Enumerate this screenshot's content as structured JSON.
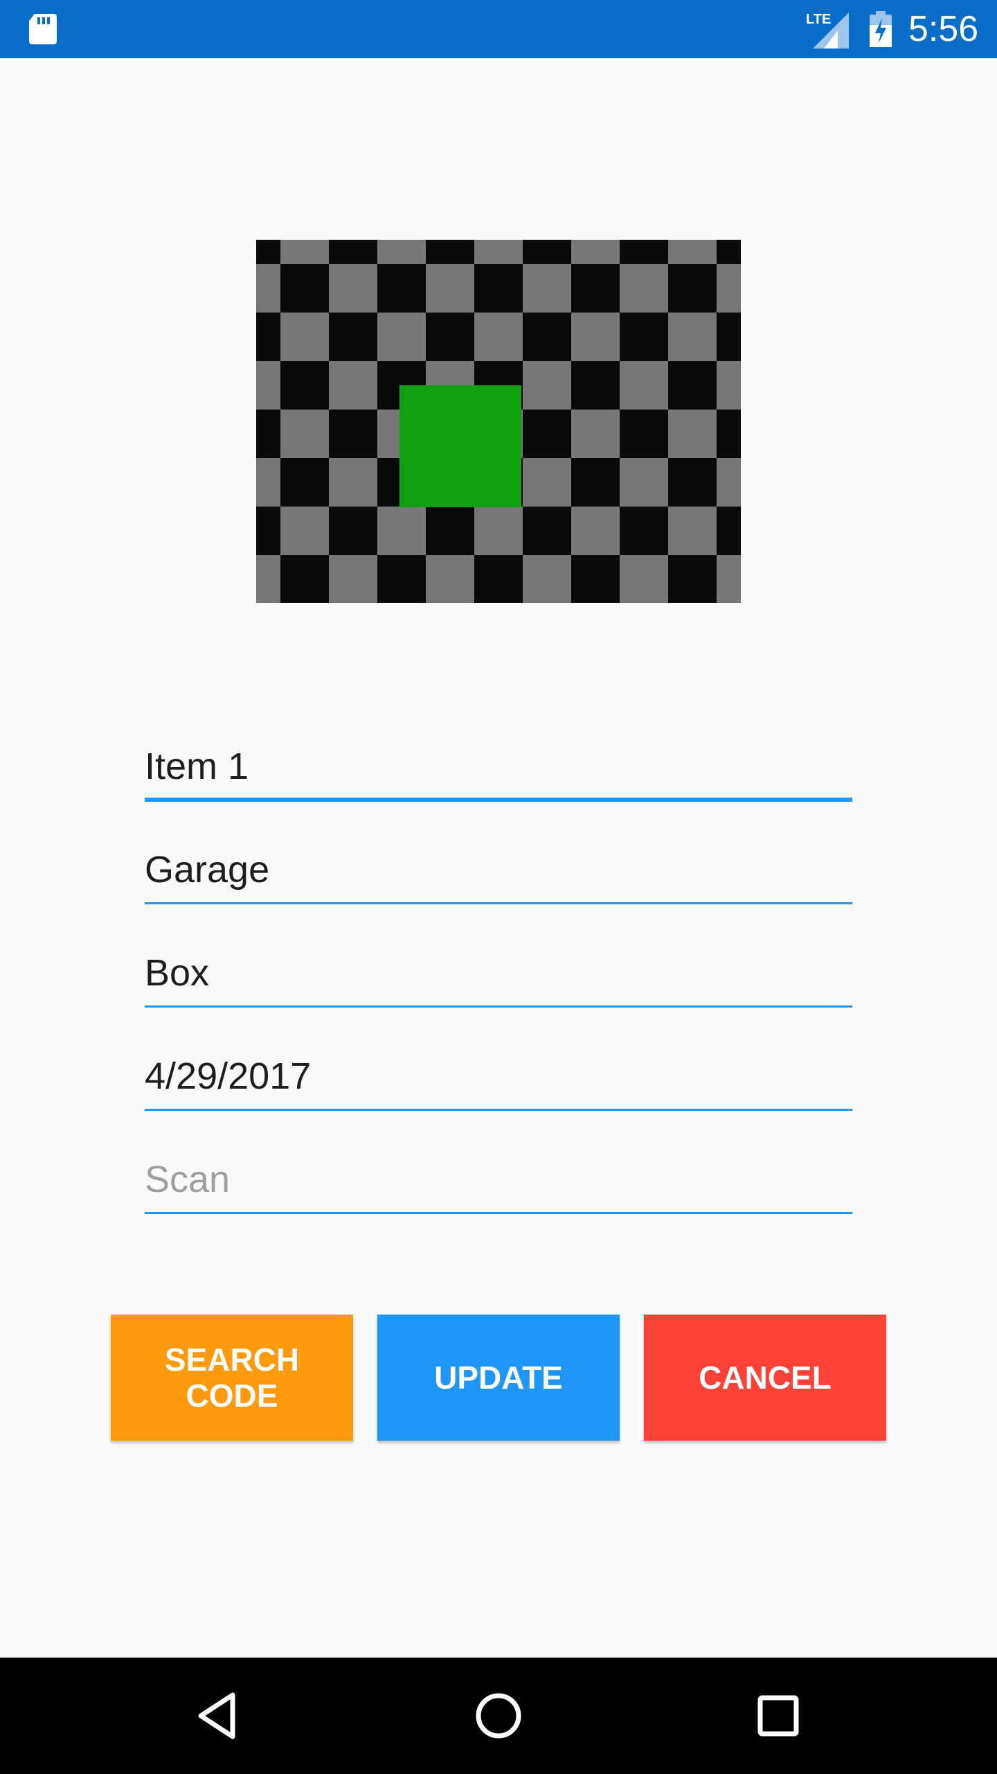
{
  "status_bar": {
    "network_label": "LTE",
    "time": "5:56",
    "icons": [
      "sd-card-icon",
      "lte-signal-icon",
      "battery-charging-icon"
    ],
    "background_color": "#0a6ec8"
  },
  "image_preview": {
    "description_icon": "checkerboard-image-with-green-square",
    "colors": {
      "dark": "#0a0a0a",
      "light": "#777777",
      "accent": "#10a010"
    }
  },
  "form": {
    "fields": [
      {
        "value": "Item 1",
        "placeholder": "",
        "focused": true
      },
      {
        "value": "Garage",
        "placeholder": ""
      },
      {
        "value": "Box",
        "placeholder": ""
      },
      {
        "value": "4/29/2017",
        "placeholder": ""
      },
      {
        "value": "",
        "placeholder": "Scan"
      }
    ],
    "underline_color": "#2196f3"
  },
  "buttons": {
    "search_code": "SEARCH\nCODE",
    "update": "UPDATE",
    "cancel": "CANCEL",
    "colors": {
      "search_code": "#ff9a0c",
      "update": "#1e96f8",
      "cancel": "#ff4136"
    }
  },
  "nav_bar": {
    "icons": [
      "back-icon",
      "home-icon",
      "recents-icon"
    ]
  }
}
